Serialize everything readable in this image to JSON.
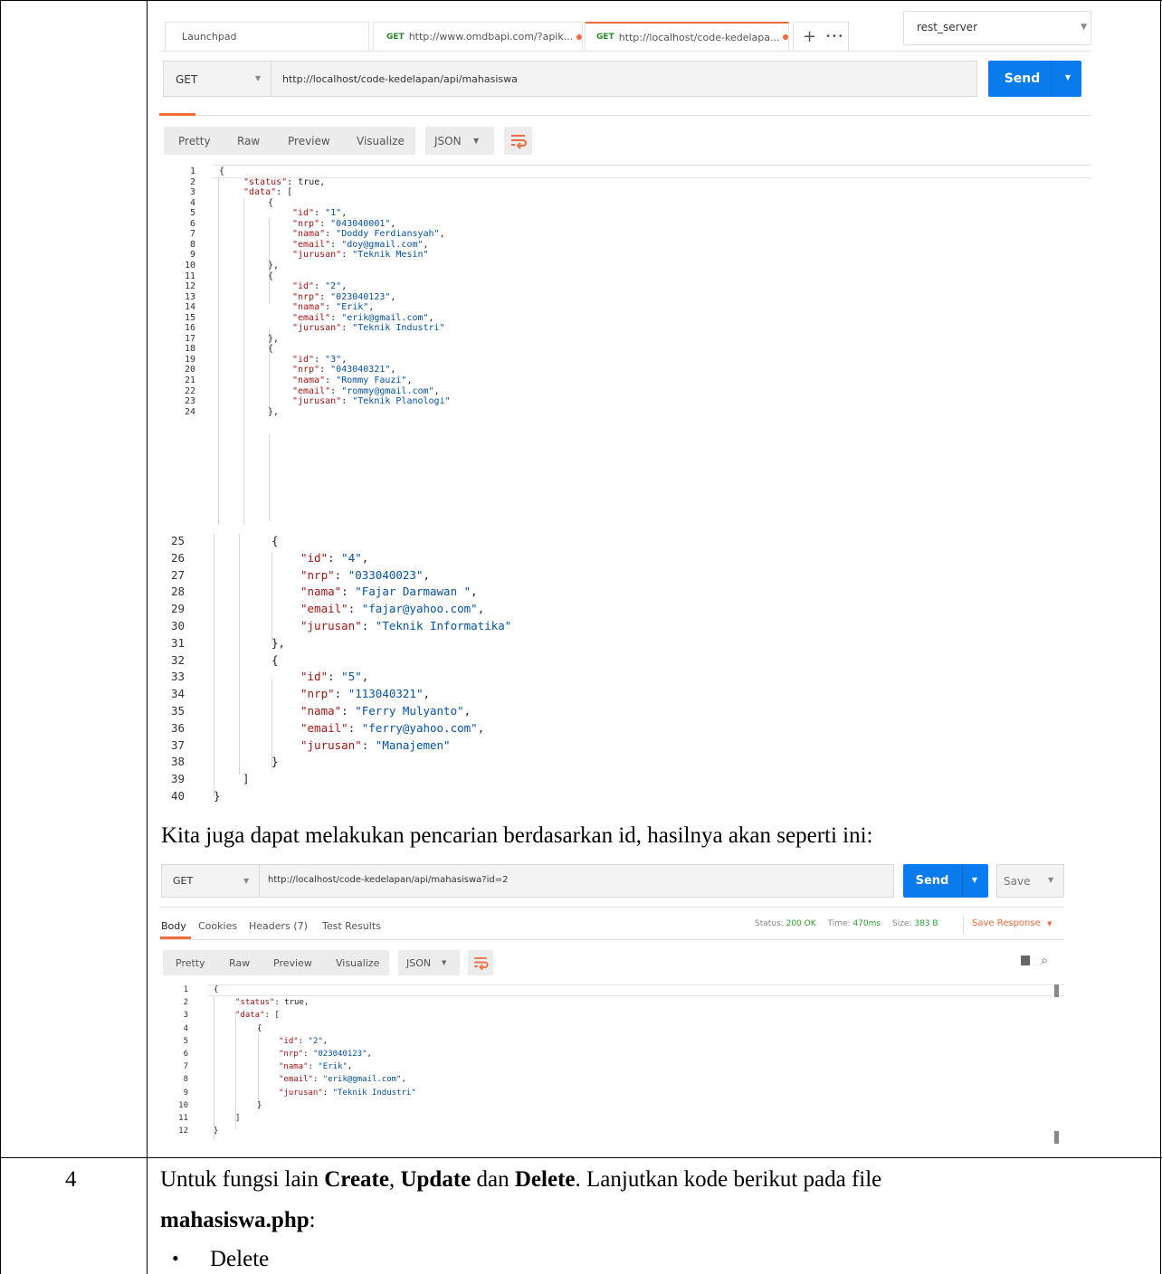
{
  "tabs": [
    {
      "label": "Launchpad"
    },
    {
      "method": "GET",
      "label": "http://www.omdbapi.com/?apik..."
    },
    {
      "method": "GET",
      "label": "http://localhost/code-kedelapa..."
    }
  ],
  "tab_plus": "+",
  "tab_more": "•••",
  "env_select": "rest_server",
  "req1": {
    "method": "GET",
    "url": "http://localhost/code-kedelapan/api/mahasiswa",
    "send": "Send"
  },
  "view_tabs": [
    "Pretty",
    "Raw",
    "Preview",
    "Visualize"
  ],
  "format": "JSON",
  "json1": {
    "line_numbers": [
      "1",
      "2",
      "3",
      "4",
      "5",
      "6",
      "7",
      "8",
      "9",
      "10",
      "11",
      "12",
      "13",
      "14",
      "15",
      "16",
      "17",
      "18",
      "19",
      "20",
      "21",
      "22",
      "23",
      "24"
    ],
    "lines": [
      {
        "parts": [
          [
            "p",
            "{"
          ]
        ]
      },
      {
        "parts": [
          [
            "k",
            "\"status\""
          ],
          [
            "p",
            ": true,"
          ]
        ]
      },
      {
        "parts": [
          [
            "k",
            "\"data\""
          ],
          [
            "p",
            ": ["
          ]
        ]
      },
      {
        "parts": [
          [
            "p",
            "{"
          ]
        ]
      },
      {
        "parts": [
          [
            "k",
            "\"id\""
          ],
          [
            "p",
            ": "
          ],
          [
            "s",
            "\"1\""
          ],
          [
            "p",
            ","
          ]
        ]
      },
      {
        "parts": [
          [
            "k",
            "\"nrp\""
          ],
          [
            "p",
            ": "
          ],
          [
            "s",
            "\"043040001\""
          ],
          [
            "p",
            ","
          ]
        ]
      },
      {
        "parts": [
          [
            "k",
            "\"nama\""
          ],
          [
            "p",
            ": "
          ],
          [
            "s",
            "\"Doddy Ferdiansyah\""
          ],
          [
            "p",
            ","
          ]
        ]
      },
      {
        "parts": [
          [
            "k",
            "\"email\""
          ],
          [
            "p",
            ": "
          ],
          [
            "s",
            "\"doy@gmail.com\""
          ],
          [
            "p",
            ","
          ]
        ]
      },
      {
        "parts": [
          [
            "k",
            "\"jurusan\""
          ],
          [
            "p",
            ": "
          ],
          [
            "s",
            "\"Teknik Mesin\""
          ]
        ]
      },
      {
        "parts": [
          [
            "p",
            "},"
          ]
        ]
      },
      {
        "parts": [
          [
            "p",
            "{"
          ]
        ]
      },
      {
        "parts": [
          [
            "k",
            "\"id\""
          ],
          [
            "p",
            ": "
          ],
          [
            "s",
            "\"2\""
          ],
          [
            "p",
            ","
          ]
        ]
      },
      {
        "parts": [
          [
            "k",
            "\"nrp\""
          ],
          [
            "p",
            ": "
          ],
          [
            "s",
            "\"023040123\""
          ],
          [
            "p",
            ","
          ]
        ]
      },
      {
        "parts": [
          [
            "k",
            "\"nama\""
          ],
          [
            "p",
            ": "
          ],
          [
            "s",
            "\"Erik\""
          ],
          [
            "p",
            ","
          ]
        ]
      },
      {
        "parts": [
          [
            "k",
            "\"email\""
          ],
          [
            "p",
            ": "
          ],
          [
            "s",
            "\"erik@gmail.com\""
          ],
          [
            "p",
            ","
          ]
        ]
      },
      {
        "parts": [
          [
            "k",
            "\"jurusan\""
          ],
          [
            "p",
            ": "
          ],
          [
            "s",
            "\"Teknik Industri\""
          ]
        ]
      },
      {
        "parts": [
          [
            "p",
            "},"
          ]
        ]
      },
      {
        "parts": [
          [
            "p",
            "{"
          ]
        ]
      },
      {
        "parts": [
          [
            "k",
            "\"id\""
          ],
          [
            "p",
            ": "
          ],
          [
            "s",
            "\"3\""
          ],
          [
            "p",
            ","
          ]
        ]
      },
      {
        "parts": [
          [
            "k",
            "\"nrp\""
          ],
          [
            "p",
            ": "
          ],
          [
            "s",
            "\"043040321\""
          ],
          [
            "p",
            ","
          ]
        ]
      },
      {
        "parts": [
          [
            "k",
            "\"nama\""
          ],
          [
            "p",
            ": "
          ],
          [
            "s",
            "\"Rommy Fauzi\""
          ],
          [
            "p",
            ","
          ]
        ]
      },
      {
        "parts": [
          [
            "k",
            "\"email\""
          ],
          [
            "p",
            ": "
          ],
          [
            "s",
            "\"rommy@gmail.com\""
          ],
          [
            "p",
            ","
          ]
        ]
      },
      {
        "parts": [
          [
            "k",
            "\"jurusan\""
          ],
          [
            "p",
            ": "
          ],
          [
            "s",
            "\"Teknik Planologi\""
          ]
        ]
      },
      {
        "parts": [
          [
            "p",
            "},"
          ]
        ]
      }
    ]
  },
  "json2": {
    "line_numbers": [
      "25",
      "26",
      "27",
      "28",
      "29",
      "30",
      "31",
      "32",
      "33",
      "34",
      "35",
      "36",
      "37",
      "38",
      "39",
      "40"
    ],
    "lines": [
      {
        "parts": [
          [
            "p",
            "{"
          ]
        ]
      },
      {
        "parts": [
          [
            "k",
            "\"id\""
          ],
          [
            "p",
            ": "
          ],
          [
            "s",
            "\"4\""
          ],
          [
            "p",
            ","
          ]
        ]
      },
      {
        "parts": [
          [
            "k",
            "\"nrp\""
          ],
          [
            "p",
            ": "
          ],
          [
            "s",
            "\"033040023\""
          ],
          [
            "p",
            ","
          ]
        ]
      },
      {
        "parts": [
          [
            "k",
            "\"nama\""
          ],
          [
            "p",
            ": "
          ],
          [
            "s",
            "\"Fajar Darmawan \""
          ],
          [
            "p",
            ","
          ]
        ]
      },
      {
        "parts": [
          [
            "k",
            "\"email\""
          ],
          [
            "p",
            ": "
          ],
          [
            "s",
            "\"fajar@yahoo.com\""
          ],
          [
            "p",
            ","
          ]
        ]
      },
      {
        "parts": [
          [
            "k",
            "\"jurusan\""
          ],
          [
            "p",
            ": "
          ],
          [
            "s",
            "\"Teknik Informatika\""
          ]
        ]
      },
      {
        "parts": [
          [
            "p",
            "},"
          ]
        ]
      },
      {
        "parts": [
          [
            "p",
            "{"
          ]
        ]
      },
      {
        "parts": [
          [
            "k",
            "\"id\""
          ],
          [
            "p",
            ": "
          ],
          [
            "s",
            "\"5\""
          ],
          [
            "p",
            ","
          ]
        ]
      },
      {
        "parts": [
          [
            "k",
            "\"nrp\""
          ],
          [
            "p",
            ": "
          ],
          [
            "s",
            "\"113040321\""
          ],
          [
            "p",
            ","
          ]
        ]
      },
      {
        "parts": [
          [
            "k",
            "\"nama\""
          ],
          [
            "p",
            ": "
          ],
          [
            "s",
            "\"Ferry Mulyanto\""
          ],
          [
            "p",
            ","
          ]
        ]
      },
      {
        "parts": [
          [
            "k",
            "\"email\""
          ],
          [
            "p",
            ": "
          ],
          [
            "s",
            "\"ferry@yahoo.com\""
          ],
          [
            "p",
            ","
          ]
        ]
      },
      {
        "parts": [
          [
            "k",
            "\"jurusan\""
          ],
          [
            "p",
            ": "
          ],
          [
            "s",
            "\"Manajemen\""
          ]
        ]
      },
      {
        "parts": [
          [
            "p",
            "}"
          ]
        ]
      },
      {
        "parts": [
          [
            "p",
            "]"
          ]
        ]
      },
      {
        "parts": [
          [
            "p",
            "}"
          ]
        ]
      }
    ]
  },
  "paragraph1": "Kita juga dapat melakukan pencarian berdasarkan id, hasilnya akan seperti ini:",
  "req2": {
    "method": "GET",
    "url": "http://localhost/code-kedelapan/api/mahasiswa?id=2",
    "send": "Send",
    "save": "Save"
  },
  "resp_tabs": [
    {
      "label": "Body"
    },
    {
      "label": "Cookies"
    },
    {
      "label": "Headers (7)"
    },
    {
      "label": "Test Results"
    }
  ],
  "status": {
    "status_label": "Status:",
    "status_value": "200 OK",
    "time_label": "Time:",
    "time_value": "470ms",
    "size_label": "Size:",
    "size_value": "383 B",
    "save_response": "Save Response"
  },
  "json3": {
    "line_numbers": [
      "1",
      "2",
      "3",
      "4",
      "5",
      "6",
      "7",
      "8",
      "9",
      "10",
      "11",
      "12"
    ],
    "lines": [
      {
        "parts": [
          [
            "p",
            "{"
          ]
        ]
      },
      {
        "parts": [
          [
            "k",
            "\"status\""
          ],
          [
            "p",
            ": true,"
          ]
        ]
      },
      {
        "parts": [
          [
            "k",
            "\"data\""
          ],
          [
            "p",
            ": ["
          ]
        ]
      },
      {
        "parts": [
          [
            "p",
            "{"
          ]
        ]
      },
      {
        "parts": [
          [
            "k",
            "\"id\""
          ],
          [
            "p",
            ": "
          ],
          [
            "s",
            "\"2\""
          ],
          [
            "p",
            ","
          ]
        ]
      },
      {
        "parts": [
          [
            "k",
            "\"nrp\""
          ],
          [
            "p",
            ": "
          ],
          [
            "s",
            "\"023040123\""
          ],
          [
            "p",
            ","
          ]
        ]
      },
      {
        "parts": [
          [
            "k",
            "\"nama\""
          ],
          [
            "p",
            ": "
          ],
          [
            "s",
            "\"Erik\""
          ],
          [
            "p",
            ","
          ]
        ]
      },
      {
        "parts": [
          [
            "k",
            "\"email\""
          ],
          [
            "p",
            ": "
          ],
          [
            "s",
            "\"erik@gmail.com\""
          ],
          [
            "p",
            ","
          ]
        ]
      },
      {
        "parts": [
          [
            "k",
            "\"jurusan\""
          ],
          [
            "p",
            ": "
          ],
          [
            "s",
            "\"Teknik Industri\""
          ]
        ]
      },
      {
        "parts": [
          [
            "p",
            "}"
          ]
        ]
      },
      {
        "parts": [
          [
            "p",
            "]"
          ]
        ]
      },
      {
        "parts": [
          [
            "p",
            "}"
          ]
        ]
      }
    ]
  },
  "row4": {
    "number": "4",
    "line1_a": "Untuk fungsi lain ",
    "line1_b": "Create",
    "line1_c": ", ",
    "line1_d": "Update",
    "line1_e": " dan ",
    "line1_f": "Delete",
    "line1_g": ". Lanjutkan kode berikut pada file",
    "line2_a": "mahasiswa.php",
    "line2_b": ":",
    "bullet": "Delete"
  },
  "colors": {
    "accent": "#097bed",
    "orange": "#f26b3a",
    "key": "#a31515",
    "string": "#0451a5",
    "status_green": "#2a9d2a"
  }
}
